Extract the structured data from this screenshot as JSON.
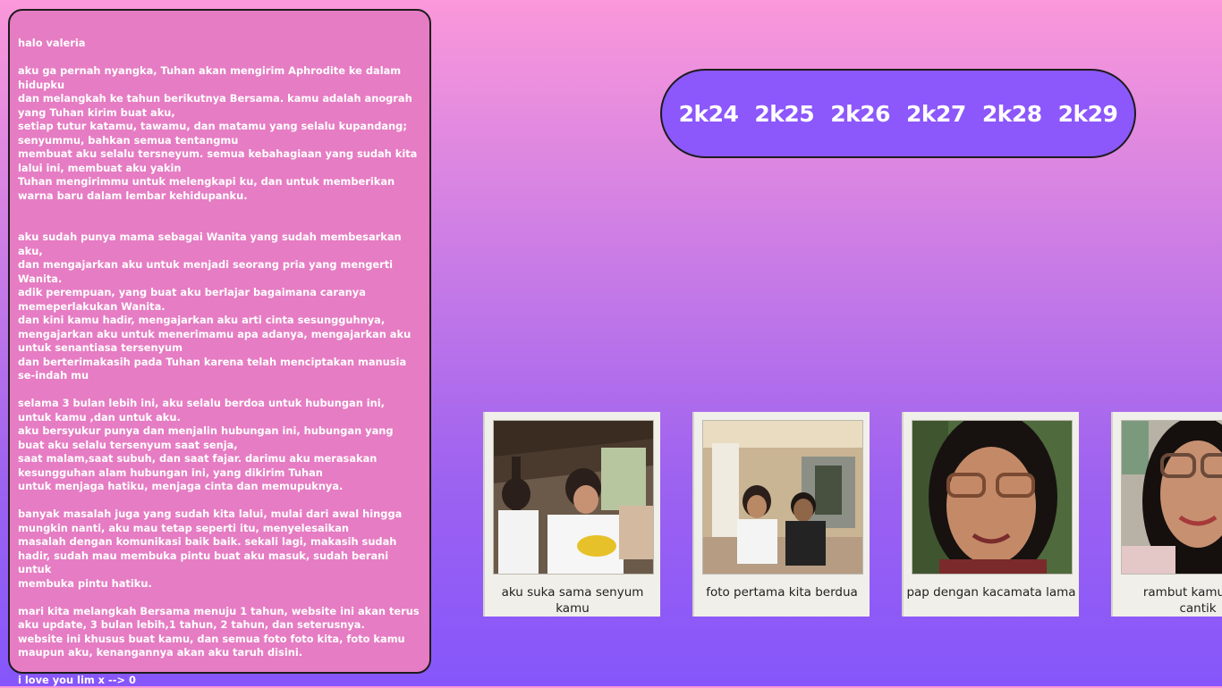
{
  "letter": {
    "greeting": "halo valeria",
    "p1": [
      "aku ga pernah nyangka, Tuhan akan mengirim Aphrodite ke dalam hidupku",
      "dan melangkah ke tahun berikutnya Bersama. kamu adalah anograh yang Tuhan kirim buat aku,",
      "setiap tutur katamu, tawamu, dan matamu yang selalu kupandang; senyummu, bahkan semua tentangmu",
      "membuat aku selalu tersneyum. semua kebahagiaan yang sudah kita lalui ini, membuat aku yakin",
      "Tuhan mengirimmu untuk melengkapi ku, dan untuk memberikan warna baru dalam lembar kehidupanku."
    ],
    "p2": [
      "aku sudah punya mama sebagai Wanita yang sudah membesarkan aku,",
      "dan mengajarkan aku untuk menjadi seorang pria yang mengerti Wanita.",
      "adik perempuan, yang buat aku berlajar bagaimana caranya memeperlakukan Wanita.",
      "dan kini kamu hadir, mengajarkan aku arti cinta sesungguhnya, mengajarkan aku untuk menerimamu apa adanya, mengajarkan aku untuk senantiasa tersenyum",
      "dan berterimakasih pada Tuhan karena telah menciptakan manusia se-indah mu"
    ],
    "p3": [
      "selama 3 bulan lebih ini, aku selalu berdoa untuk hubungan ini, untuk kamu ,dan untuk aku.",
      "aku bersyukur punya dan menjalin hubungan ini, hubungan yang buat aku selalu tersenyum saat senja,",
      "saat malam,saat subuh, dan saat fajar. darimu aku merasakan kesungguhan alam hubungan ini, yang dikirim Tuhan",
      "untuk menjaga hatiku, menjaga cinta dan memupuknya."
    ],
    "p4": [
      "banyak masalah juga yang sudah kita lalui, mulai dari awal hingga mungkin nanti, aku mau tetap seperti itu, menyelesaikan",
      "masalah dengan komunikasi baik baik. sekali lagi, makasih sudah hadir, sudah mau membuka pintu buat aku masuk, sudah berani untuk",
      "membuka pintu hatiku."
    ],
    "p5": [
      "mari kita melangkah Bersama menuju 1 tahun, website ini akan terus aku update, 3 bulan lebih,1 tahun, 2 tahun, dan seterusnya.",
      "website ini khusus buat kamu, dan semua foto foto kita, foto kamu maupun aku, kenangannya akan aku taruh disini."
    ],
    "closing": "i love you lim x --> 0"
  },
  "years": [
    "2k24",
    "2k25",
    "2k26",
    "2k27",
    "2k28",
    "2k29"
  ],
  "photos": [
    {
      "caption": "aku suka sama senyum kamu"
    },
    {
      "caption": "foto pertama kita berdua"
    },
    {
      "caption": "pap dengan kacamata lama"
    },
    {
      "caption": "rambut kamu tem\ncantik"
    }
  ],
  "colors": {
    "letter_bg": "#e67cc3",
    "year_pill": "#8c57fb",
    "bg_top": "#fb98da",
    "bg_bottom": "#8656fb"
  }
}
